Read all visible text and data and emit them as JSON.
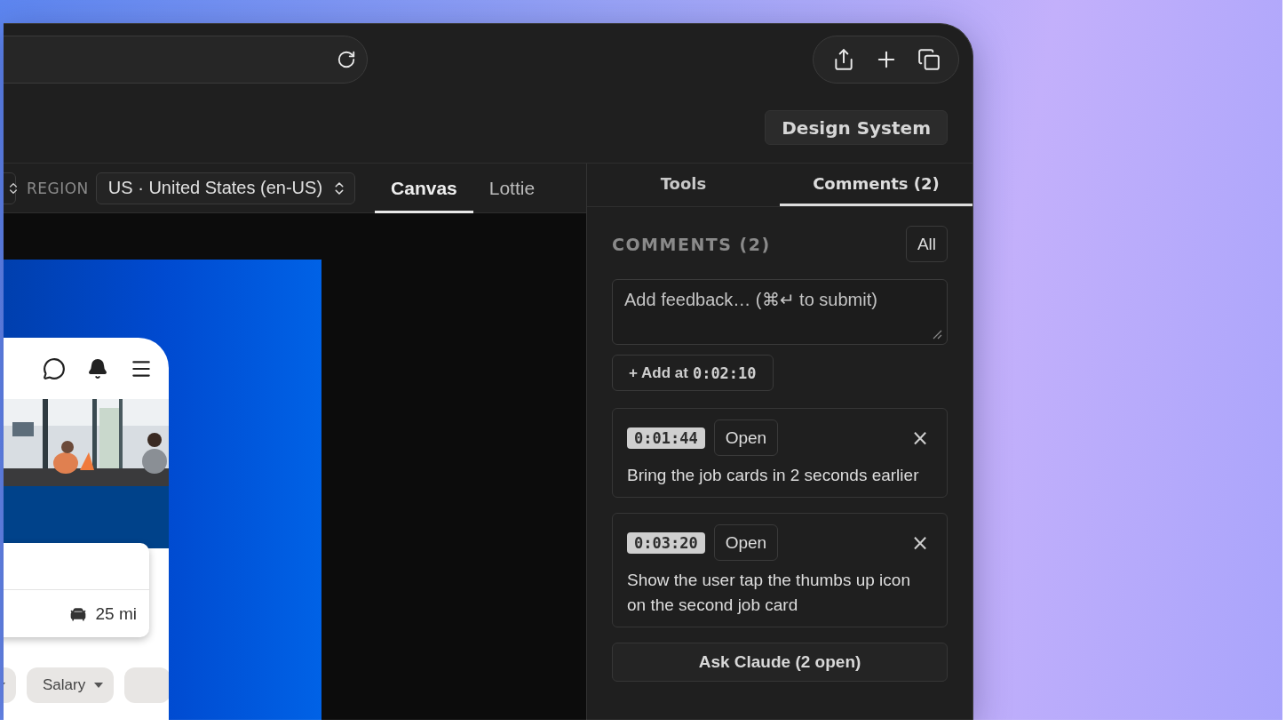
{
  "browser": {
    "toolbar_buttons": [
      {
        "kind": "share"
      },
      {
        "kind": "add"
      },
      {
        "kind": "tabs"
      }
    ]
  },
  "header": {
    "design_system_button": "Design System"
  },
  "canvas_toolbar": {
    "region_label": "REGION",
    "region_select": "US · United States (en-US)",
    "tabs": [
      {
        "label": "Canvas",
        "selected": true
      },
      {
        "label": "Lottie",
        "selected": false
      }
    ]
  },
  "preview": {
    "distance": "25 mi",
    "chips": [
      {
        "kind": "cut"
      },
      {
        "label": "Salary"
      }
    ]
  },
  "panel": {
    "tabs": [
      {
        "label": "Tools",
        "selected": false
      },
      {
        "label": "Comments (2)",
        "selected": true
      }
    ],
    "heading": "COMMENTS (2)",
    "filter_button": "All",
    "feedback": {
      "placeholder": "Add feedback… (⌘↵ to submit)"
    },
    "add_button": {
      "label": "+ Add at",
      "time": "0:02:10"
    },
    "comments": [
      {
        "time": "0:01:44",
        "open_button": "Open",
        "close": "×",
        "text": "Bring the job cards in 2 seconds earlier"
      },
      {
        "time": "0:03:20",
        "open_button": "Open",
        "close": "×",
        "text": "Show the user tap the thumbs up icon on the second job card"
      }
    ],
    "ask_button": "Ask Claude (2 open)"
  }
}
